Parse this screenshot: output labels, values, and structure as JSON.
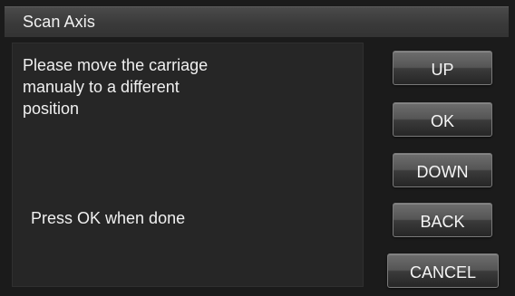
{
  "header": {
    "title": "Scan Axis"
  },
  "message": {
    "instruction": "Please move the carriage\nmanualy to a different\nposition",
    "hint": "Press OK when done"
  },
  "buttons": {
    "up": "UP",
    "ok": "OK",
    "down": "DOWN",
    "back": "BACK",
    "cancel": "CANCEL"
  },
  "colors": {
    "background": "#1b1b1b",
    "title_bar": "#3a3a3a",
    "panel": "#262626",
    "text": "#f0f0f0"
  }
}
